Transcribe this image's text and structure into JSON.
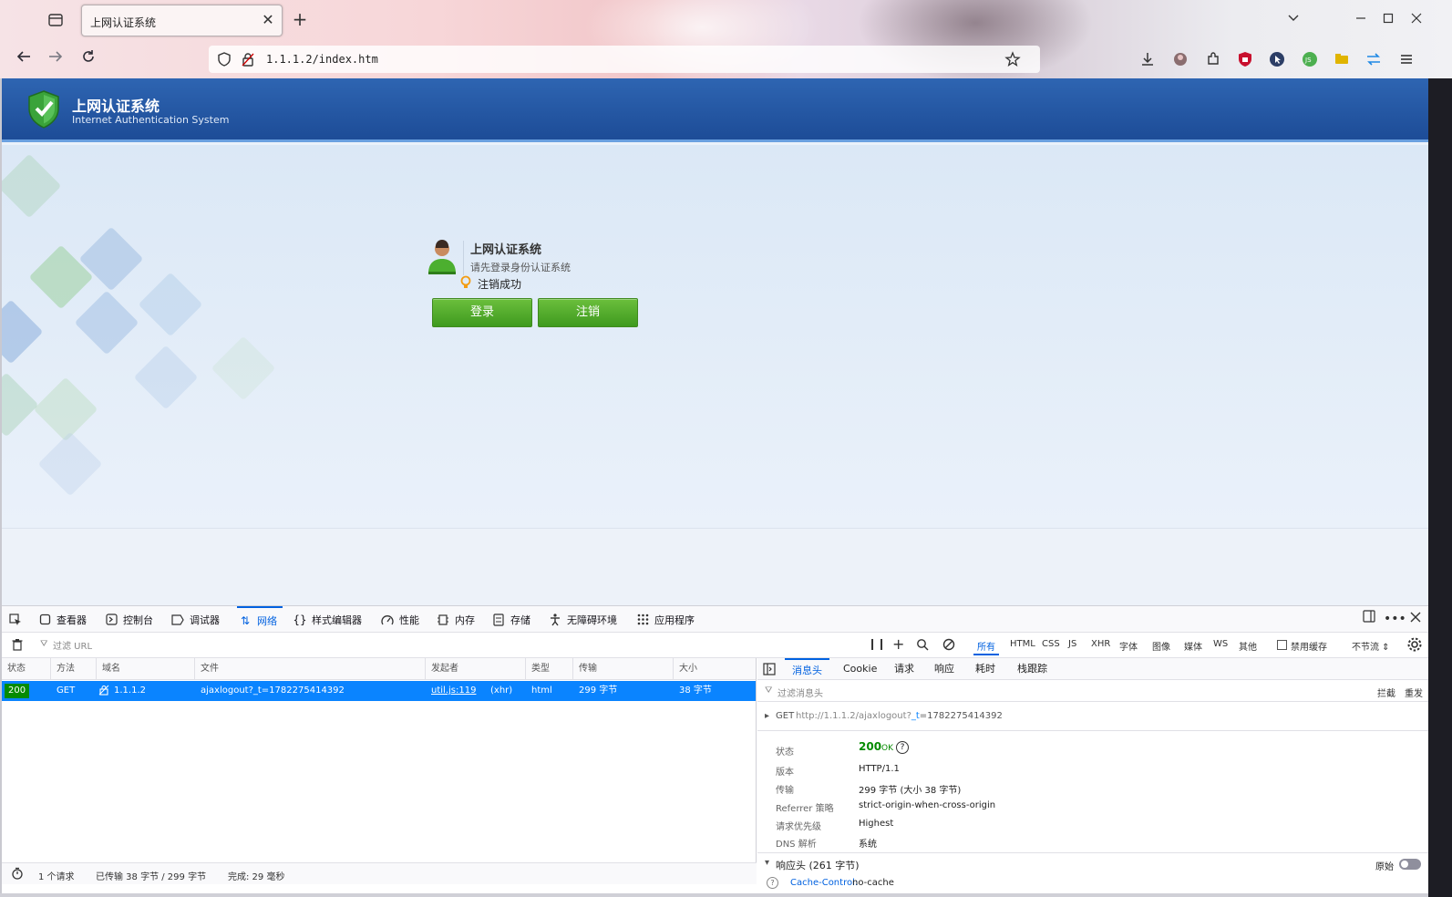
{
  "browser": {
    "tab_title": "上网认证系统",
    "url": "1.1.1.2/index.htm",
    "tab_close": "✕",
    "new_tab": "+"
  },
  "site": {
    "title": "上网认证系统",
    "subtitle": "Internet Authentication System"
  },
  "login": {
    "title": "上网认证系统",
    "hint": "请先登录身份认证系统",
    "status": "注销成功",
    "login_button": "登录",
    "logout_button": "注销"
  },
  "devtools": {
    "tabs": [
      "查看器",
      "控制台",
      "调试器",
      "网络",
      "样式编辑器",
      "性能",
      "内存",
      "存储",
      "无障碍环境",
      "应用程序"
    ],
    "filter_placeholder": "过滤 URL",
    "type_filters": [
      "所有",
      "HTML",
      "CSS",
      "JS",
      "XHR",
      "字体",
      "图像",
      "媒体",
      "WS",
      "其他"
    ],
    "disable_cache": "禁用缓存",
    "throttle": "不节流 ⇕",
    "columns": [
      "状态",
      "方法",
      "域名",
      "文件",
      "发起者",
      "类型",
      "传输",
      "大小"
    ],
    "request": {
      "status": "200",
      "method": "GET",
      "domain": "1.1.1.2",
      "file": "ajaxlogout?_t=1782275414392",
      "initiator": "util.js:119",
      "initiator_suffix": "(xhr)",
      "type": "html",
      "transferred": "299 字节",
      "size": "38 字节"
    },
    "statusbar": {
      "requests": "1 个请求",
      "transferred": "已传输 38 字节 / 299 字节",
      "finish": "完成: 29 毫秒"
    },
    "side_tabs": [
      "消息头",
      "Cookie",
      "请求",
      "响应",
      "耗时",
      "栈跟踪"
    ],
    "side_filter": "过滤消息头",
    "side_filter_actions": [
      "拦截",
      "重发"
    ],
    "request_line_method": "GET",
    "request_line_url_prefix": "http://1.1.1.2/ajaxlogout?",
    "request_line_url_param": "_t",
    "request_line_url_rest": "=1782275414392",
    "details": [
      {
        "key": "状态",
        "value": "200",
        "extra": "OK"
      },
      {
        "key": "版本",
        "value": "HTTP/1.1"
      },
      {
        "key": "传输",
        "value": "299 字节 (大小 38 字节)"
      },
      {
        "key": "Referrer 策略",
        "value": "strict-origin-when-cross-origin"
      },
      {
        "key": "请求优先级",
        "value": "Highest"
      },
      {
        "key": "DNS 解析",
        "value": "系统"
      }
    ],
    "response_headers": "响应头 (261 字节)",
    "raw_label": "原始",
    "cache_control_key": "Cache-Control:",
    "cache_control_value": "no-cache"
  },
  "colors": {
    "header_blue": "#1d4c97",
    "button_green": "#3f9a1f",
    "selection_blue": "#0a84ff",
    "active_tab": "#0061e0",
    "status_ok": "#058b00"
  }
}
